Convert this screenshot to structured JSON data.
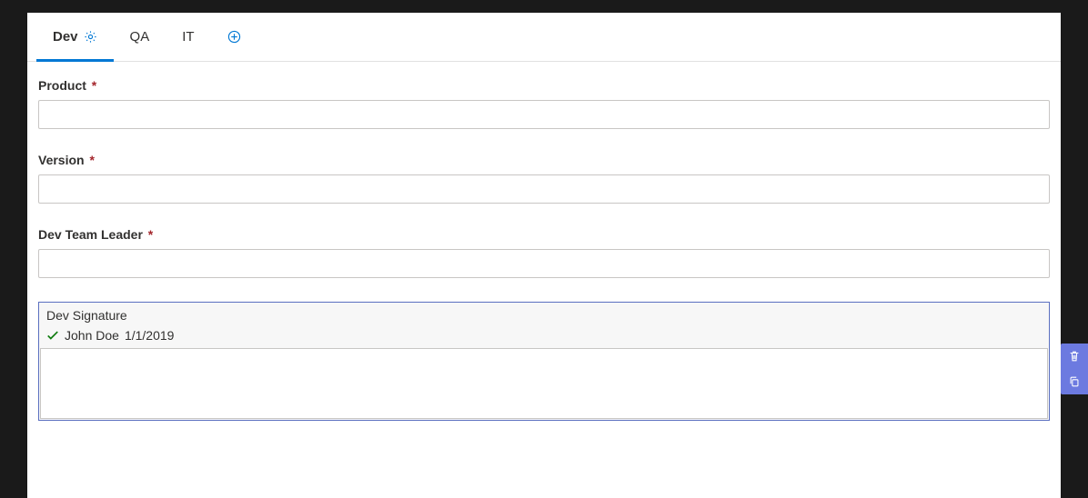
{
  "tabs": {
    "items": [
      {
        "label": "Dev",
        "active": true,
        "hasGear": true
      },
      {
        "label": "QA",
        "active": false,
        "hasGear": false
      },
      {
        "label": "IT",
        "active": false,
        "hasGear": false
      }
    ]
  },
  "fields": {
    "product": {
      "label": "Product",
      "required": true,
      "value": ""
    },
    "version": {
      "label": "Version",
      "required": true,
      "value": ""
    },
    "teamLeader": {
      "label": "Dev Team Leader",
      "required": true,
      "value": ""
    }
  },
  "signature": {
    "title": "Dev Signature",
    "name": "John Doe",
    "date": "1/1/2019",
    "text": ""
  },
  "icons": {
    "gear": "gear-icon",
    "addTab": "add-circle-icon",
    "check": "checkmark-icon",
    "trash": "trash-icon",
    "copy": "copy-icon"
  },
  "colors": {
    "accent": "#0078d4",
    "selectionBorder": "#5a6fc0",
    "sideActions": "#6c7ae0",
    "required": "#a4262c",
    "success": "#107c10"
  }
}
